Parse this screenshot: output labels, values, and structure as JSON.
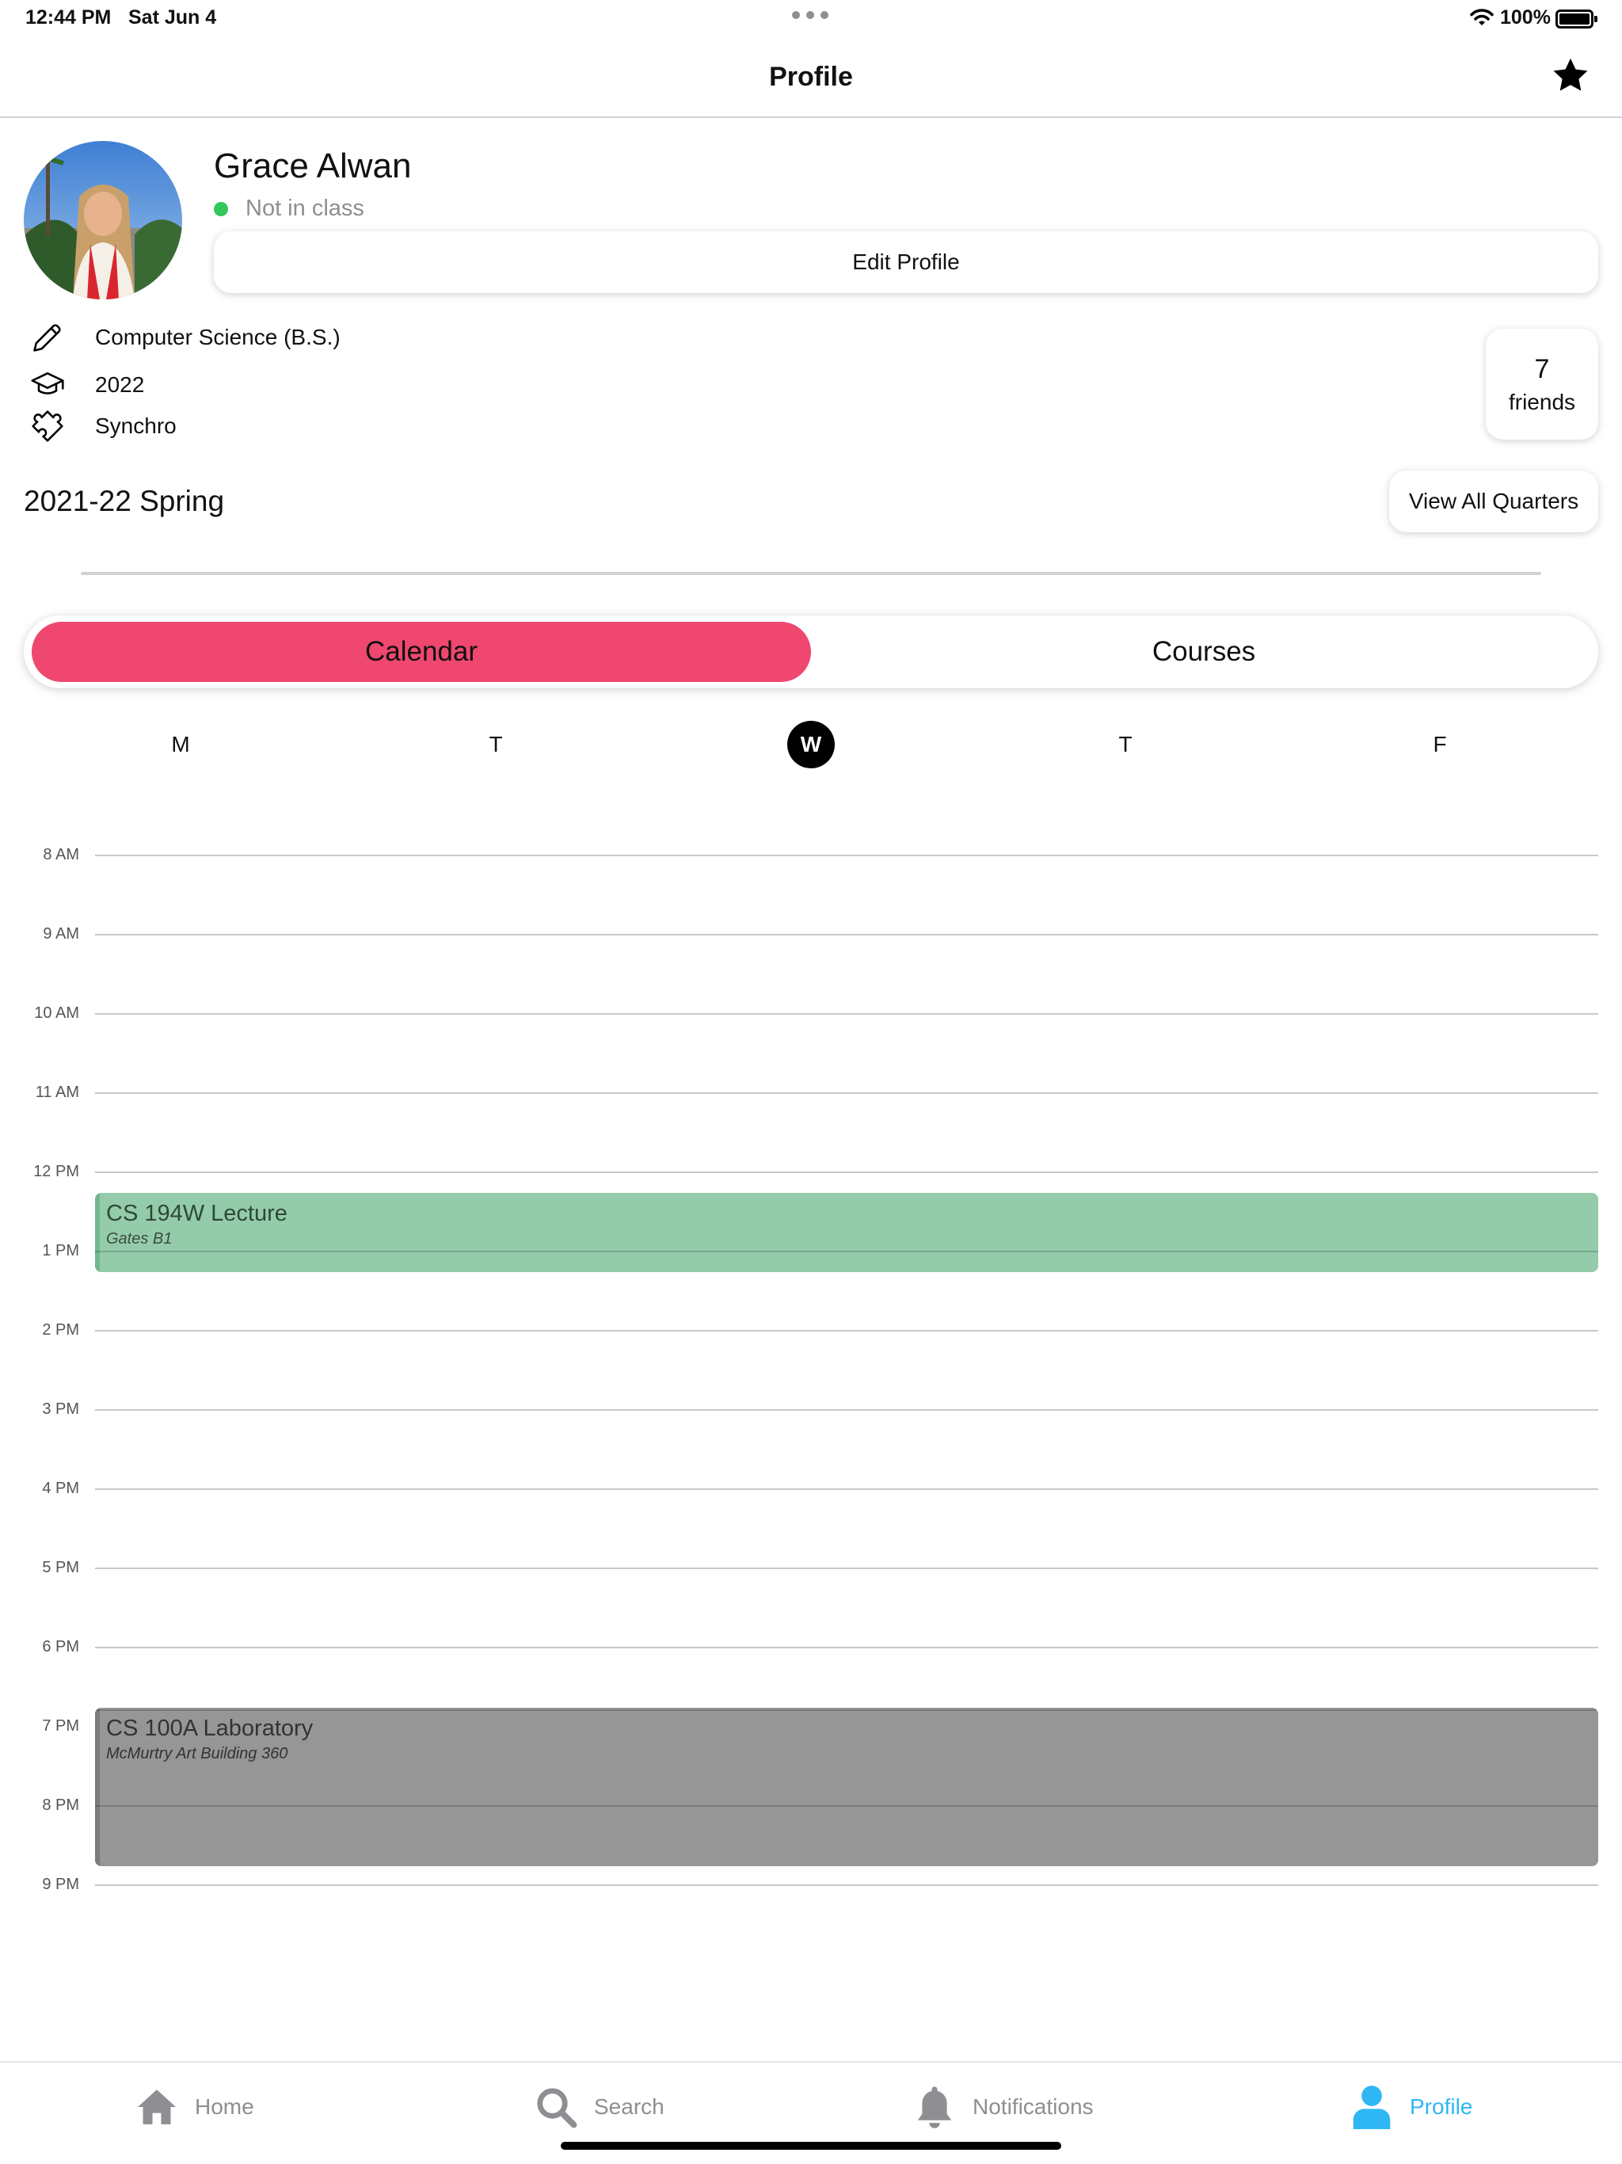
{
  "status_bar": {
    "time": "12:44 PM",
    "date": "Sat Jun 4",
    "battery": "100%"
  },
  "nav": {
    "title": "Profile",
    "favorite_icon": "star-icon"
  },
  "profile": {
    "name": "Grace Alwan",
    "status": "Not in class",
    "status_color": "#34c759",
    "edit_label": "Edit Profile",
    "major": "Computer Science (B.S.)",
    "year": "2022",
    "activity": "Synchro",
    "friends_count": "7",
    "friends_label": "friends"
  },
  "quarter": {
    "title": "2021-22 Spring",
    "view_all_label": "View All Quarters"
  },
  "segments": {
    "calendar": "Calendar",
    "courses": "Courses",
    "active_color": "#ef476f"
  },
  "weekdays": [
    "M",
    "T",
    "W",
    "T",
    "F"
  ],
  "selected_day": "W",
  "hours": [
    "8 AM",
    "9 AM",
    "10 AM",
    "11 AM",
    "12 PM",
    "1 PM",
    "2 PM",
    "3 PM",
    "4 PM",
    "5 PM",
    "6 PM",
    "7 PM",
    "8 PM",
    "9 PM"
  ],
  "events": [
    {
      "title": "CS 194W Lecture",
      "location": "Gates B1",
      "color": "#94ccab"
    },
    {
      "title": "CS 100A Laboratory",
      "location": "McMurtry Art Building 360",
      "color": "#969696"
    }
  ],
  "tabs": {
    "home": "Home",
    "search": "Search",
    "notifications": "Notifications",
    "profile": "Profile",
    "active_color": "#2fb7f5"
  }
}
